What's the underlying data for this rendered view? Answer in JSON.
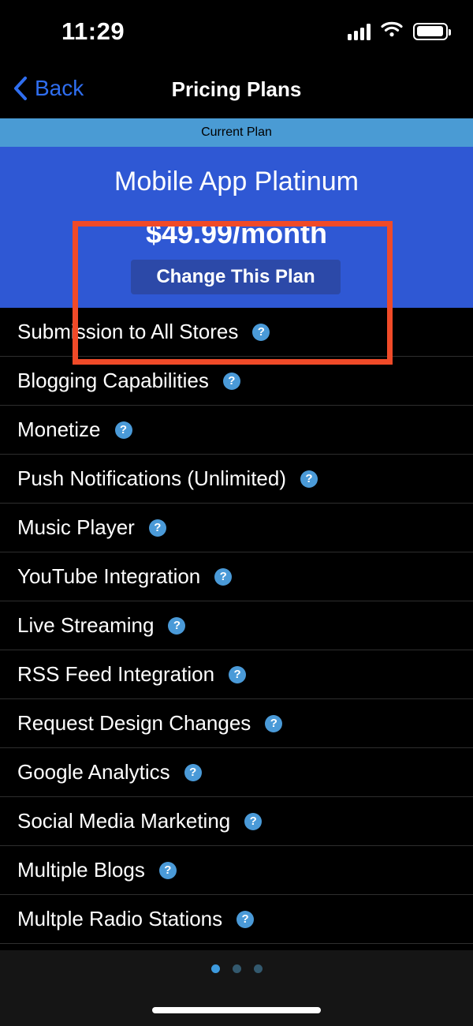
{
  "status_bar": {
    "time": "11:29",
    "cellular_icon": "cellular-signal-icon",
    "wifi_icon": "wifi-icon",
    "battery_icon": "battery-icon"
  },
  "nav": {
    "back_label": "Back",
    "back_icon": "chevron-left-icon",
    "title": "Pricing Plans"
  },
  "plan_banner": {
    "label": "Current Plan"
  },
  "plan_card": {
    "name": "Mobile App Platinum",
    "price": "$49.99/month",
    "change_button_label": "Change This Plan"
  },
  "features": [
    {
      "label": "Submission to All Stores",
      "help_icon": "help-icon"
    },
    {
      "label": "Blogging Capabilities",
      "help_icon": "help-icon"
    },
    {
      "label": "Monetize",
      "help_icon": "help-icon"
    },
    {
      "label": "Push Notifications (Unlimited)",
      "help_icon": "help-icon"
    },
    {
      "label": "Music Player",
      "help_icon": "help-icon"
    },
    {
      "label": "YouTube Integration",
      "help_icon": "help-icon"
    },
    {
      "label": "Live Streaming",
      "help_icon": "help-icon"
    },
    {
      "label": "RSS Feed Integration",
      "help_icon": "help-icon"
    },
    {
      "label": "Request Design Changes",
      "help_icon": "help-icon"
    },
    {
      "label": "Google Analytics",
      "help_icon": "help-icon"
    },
    {
      "label": "Social Media Marketing",
      "help_icon": "help-icon"
    },
    {
      "label": "Multiple Blogs",
      "help_icon": "help-icon"
    },
    {
      "label": "Multple Radio Stations",
      "help_icon": "help-icon"
    }
  ],
  "help_glyph": "?",
  "footer": {
    "page_dots": [
      {
        "state": "active"
      },
      {
        "state": "inactive"
      },
      {
        "state": "inactive"
      }
    ],
    "home_indicator": "home-indicator"
  },
  "annotation": {
    "shape": "rectangle-highlight",
    "color": "#f04a28"
  },
  "colors": {
    "banner_blue": "#4a9bd4",
    "card_blue": "#2f58d4",
    "button_blue": "#2c49a8",
    "link_blue": "#2f6ef0",
    "help_blue": "#4a9ad8",
    "annotation_red": "#f04a28",
    "background_black": "#000000",
    "footer_gray": "#151515"
  }
}
